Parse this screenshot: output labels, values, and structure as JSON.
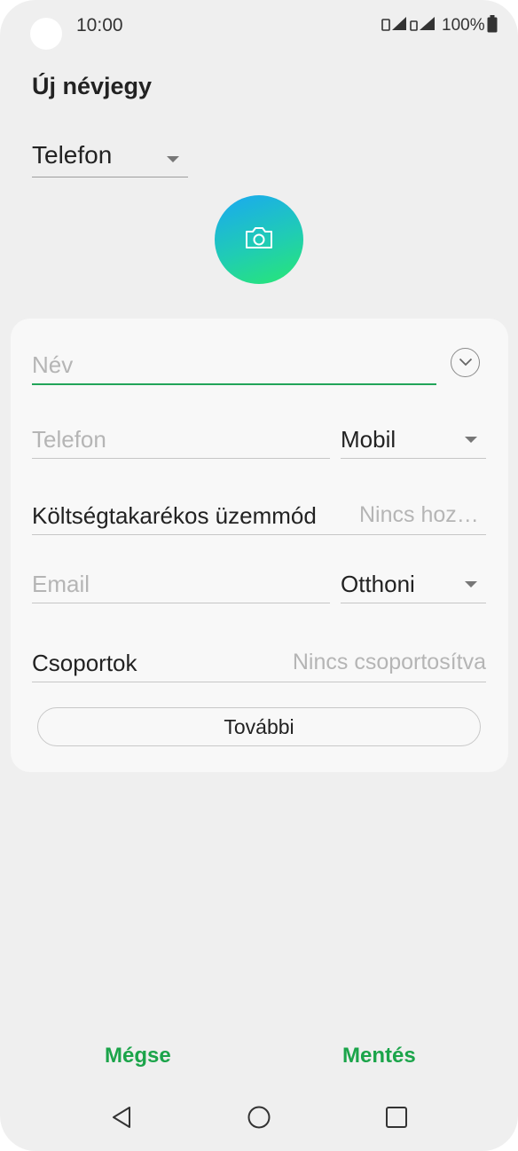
{
  "status_bar": {
    "time": "10:00",
    "battery": "100%"
  },
  "header": {
    "title": "Új névjegy"
  },
  "account_select": {
    "value": "Telefon"
  },
  "photo": {
    "icon": "camera-icon"
  },
  "form": {
    "name_placeholder": "Név",
    "phone_placeholder": "Telefon",
    "phone_type": "Mobil",
    "power_saving_label": "Költségtakarékos üzemmód",
    "power_saving_value": "Nincs hoz…",
    "email_placeholder": "Email",
    "email_type": "Otthoni",
    "groups_label": "Csoportok",
    "groups_value": "Nincs csoportosítva",
    "more_button": "További"
  },
  "actions": {
    "cancel": "Mégse",
    "save": "Mentés"
  },
  "colors": {
    "accent": "#1ba44a",
    "name_underline": "#22a55a",
    "background": "#efefef",
    "card": "#f8f8f8"
  }
}
